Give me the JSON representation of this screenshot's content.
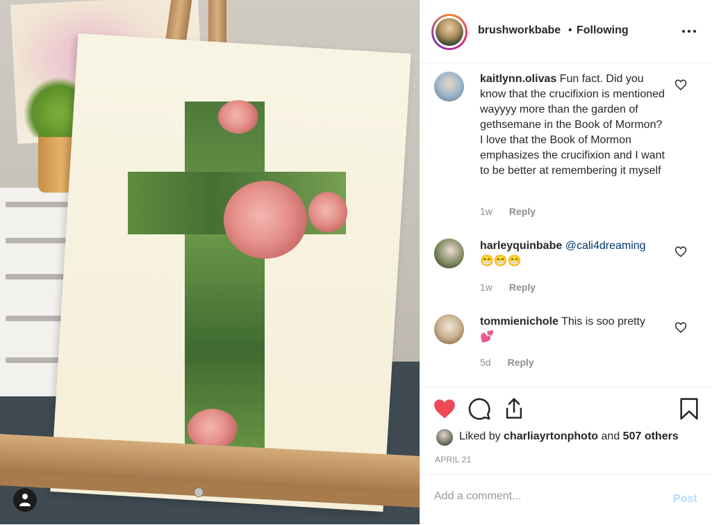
{
  "post": {
    "username": "brushworkbabe",
    "separator": "•",
    "follow_state": "Following",
    "more_icon": "more-horizontal-icon"
  },
  "comments": [
    {
      "username": "kaitlynn.olivas",
      "text": "Fun fact. Did you know that the crucifixion is mentioned wayyyy more than the garden of gethsemane in the Book of Mormon? I love that the Book of Mormon emphasizes the crucifixion and I want to be better at remembering it myself",
      "age": "1w",
      "reply": "Reply"
    },
    {
      "username": "harleyquinbabe",
      "mention": "@cali4dreaming",
      "emojis": "😁😁😁",
      "age": "1w",
      "reply": "Reply"
    },
    {
      "username": "tommienichole",
      "text": "This is soo pretty",
      "emojis": "💕",
      "age": "5d",
      "reply": "Reply"
    }
  ],
  "actions": {
    "like_icon": "heart-filled-icon",
    "comment_icon": "comment-icon",
    "share_icon": "share-icon",
    "save_icon": "bookmark-icon",
    "like_color": "#ed4956"
  },
  "likes": {
    "prefix": "Liked by",
    "user": "charliayrtonphoto",
    "and": "and",
    "others": "507 others"
  },
  "date": "APRIL 21",
  "composer": {
    "placeholder": "Add a comment...",
    "post_label": "Post"
  }
}
